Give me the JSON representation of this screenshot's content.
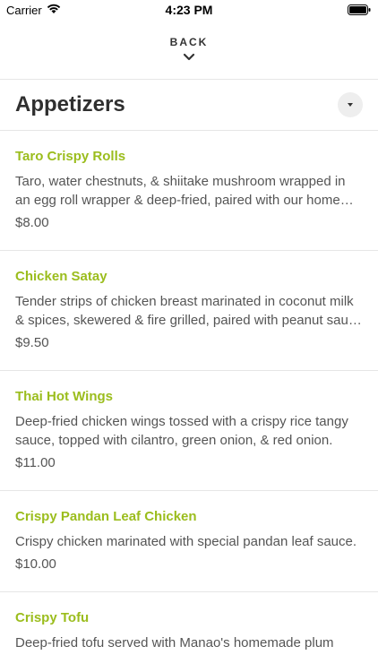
{
  "status_bar": {
    "carrier": "Carrier",
    "time": "4:23 PM"
  },
  "nav": {
    "back_label": "BACK"
  },
  "section": {
    "title": "Appetizers"
  },
  "menu_items": [
    {
      "name": "Taro Crispy Rolls",
      "description": "Taro, water chestnuts, & shiitake mushroom wrapped in an egg roll wrapper & deep-fried, paired with our home…",
      "price": "$8.00"
    },
    {
      "name": "Chicken Satay",
      "description": "Tender strips of chicken breast marinated in coconut milk & spices, skewered & fire grilled, paired with peanut sau…",
      "price": "$9.50"
    },
    {
      "name": "Thai Hot Wings",
      "description": "Deep-fried chicken wings tossed with a crispy rice tangy sauce, topped with cilantro, green onion, & red onion.",
      "price": "$11.00"
    },
    {
      "name": "Crispy Pandan Leaf Chicken",
      "description": "Crispy chicken marinated with special pandan leaf sauce.",
      "price": "$10.00"
    },
    {
      "name": "Crispy Tofu",
      "description": "Deep-fried tofu served with Manao's homemade plum",
      "price": ""
    }
  ],
  "colors": {
    "accent": "#9bbd1d",
    "divider": "#e6e6e6"
  }
}
